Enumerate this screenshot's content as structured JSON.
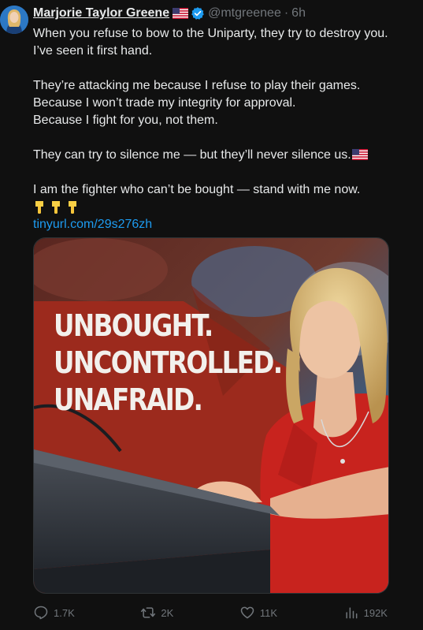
{
  "tweet": {
    "display_name": "Marjorie Taylor Greene",
    "handle": "@mtgreenee",
    "separator": "·",
    "time": "6h",
    "lines": [
      "When you refuse to bow to the Uniparty, they try to destroy you.",
      "I’ve seen it first hand.",
      "They’re attacking me because I refuse to play their games.",
      "Because I won’t trade my integrity for approval.",
      "Because I fight for you, not them.",
      "They can try to silence me — but they’ll never silence us.",
      "I am the fighter who can’t be bought — stand with me now."
    ],
    "link": "tinyurl.com/29s276zh",
    "icons": {
      "flag": "us-flag-icon",
      "verified": "verified-badge-icon",
      "emoji": "backhand-index-pointing-down-icon"
    }
  },
  "media": {
    "headline": [
      "UNBOUGHT.",
      "UNCONTROLLED.",
      "UNAFRAID."
    ],
    "colors": {
      "accent_red": "#9c2a1d",
      "dress_red": "#c8231e",
      "podium": "#3b4048"
    }
  },
  "actions": {
    "replies": "1.7K",
    "reposts": "2K",
    "likes": "11K",
    "views": "192K"
  },
  "colors": {
    "background": "#101010",
    "text": "#e7e9ea",
    "muted": "#71767b",
    "link": "#1d9bf0",
    "verified": "#1d9bf0"
  }
}
